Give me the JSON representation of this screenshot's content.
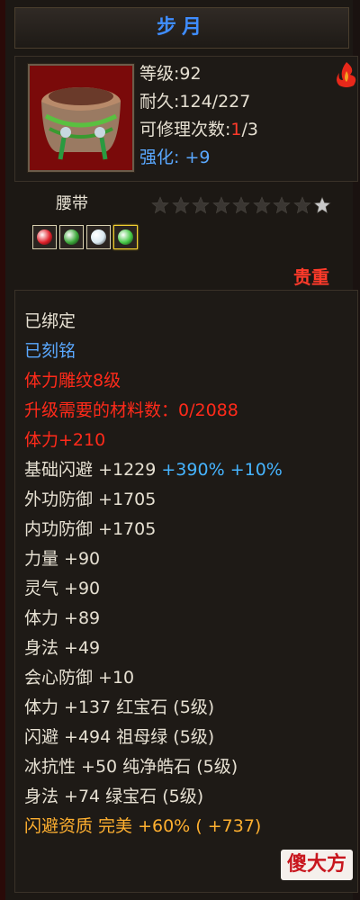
{
  "item": {
    "name": "步月",
    "level_label": "等级:",
    "level": "92",
    "durability_label": "耐久:",
    "durability": "124/227",
    "repair_label": "可修理次数:",
    "repair_used": "1",
    "repair_total": "/3",
    "enhance_label": "强化:",
    "enhance": "+9",
    "type": "腰带",
    "stars_total": 9,
    "stars_filled": 0,
    "quality": "贵重",
    "icon": "belt-icon"
  },
  "gems": [
    {
      "name": "red-gem-icon",
      "color": "#e0202a"
    },
    {
      "name": "green-gem-icon",
      "color": "#3ca83a"
    },
    {
      "name": "white-gem-icon",
      "color": "#d8e8f0"
    },
    {
      "name": "emerald-gem-icon",
      "color": "#46c846"
    }
  ],
  "attributes": {
    "bound": "已绑定",
    "engraved": "已刻铭",
    "pattern": "体力雕纹8级",
    "materials": "升级需要的材料数：0/2088",
    "hp_bonus": "体力+210",
    "dodge_label": "基础闪避",
    "dodge_value": "+1229",
    "dodge_pct1": "+390%",
    "dodge_pct2": "+10%",
    "lines": [
      "外功防御 +1705",
      "内功防御 +1705",
      "力量 +90",
      "灵气 +90",
      "体力 +89",
      "身法 +49",
      "会心防御 +10",
      "体力 +137 红宝石 (5级)",
      "闪避 +494 祖母绿 (5级)",
      "冰抗性 +50 纯净皓石 (5级)",
      "身法 +74 绿宝石 (5级)"
    ],
    "aptitude": "闪避资质  完美 +60% ( +737)"
  },
  "watermark": {
    "text_a": "傻",
    "text_b": "大方"
  },
  "colors": {
    "title": "#3f8dff",
    "red": "#ff2a1a",
    "blue": "#5aa8ff",
    "orange": "#ffb030"
  }
}
